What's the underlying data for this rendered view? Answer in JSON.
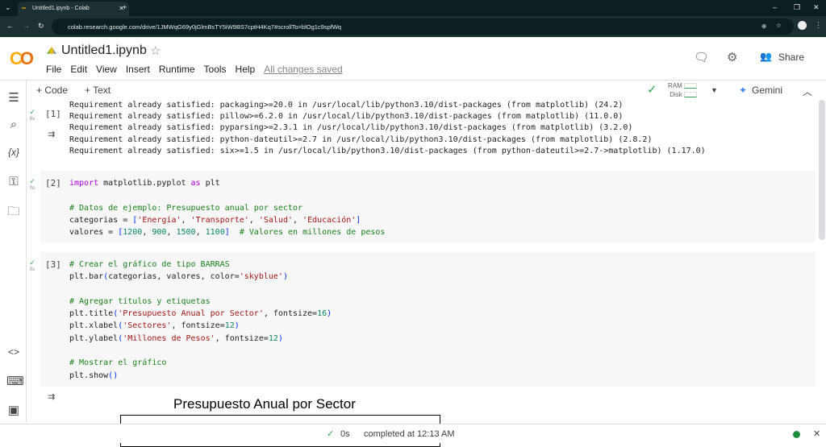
{
  "browser": {
    "tab_title": "Untitled1.ipynb - Colab",
    "url": "colab.research.google.com/drive/1JMWqG69y0jGlmBsTY5iW9BS7cptH4Kq7#scrollTo=blOg1c9spfWq"
  },
  "header": {
    "logo": "CO",
    "title": "Untitled1.ipynb",
    "menu": [
      "File",
      "Edit",
      "View",
      "Insert",
      "Runtime",
      "Tools",
      "Help"
    ],
    "saved": "All changes saved",
    "share": "Share"
  },
  "toolbar": {
    "code": "+ Code",
    "text": "+ Text",
    "ram": "RAM",
    "disk": "Disk",
    "gemini": "Gemini"
  },
  "cells": [
    {
      "num": "[1]",
      "time": "8s",
      "output": [
        "Requirement already satisfied: packaging>=20.0 in /usr/local/lib/python3.10/dist-packages (from matplotlib) (24.2)",
        "Requirement already satisfied: pillow>=6.2.0 in /usr/local/lib/python3.10/dist-packages (from matplotlib) (11.0.0)",
        "Requirement already satisfied: pyparsing>=2.3.1 in /usr/local/lib/python3.10/dist-packages (from matplotlib) (3.2.0)",
        "Requirement already satisfied: python-dateutil>=2.7 in /usr/local/lib/python3.10/dist-packages (from matplotlib) (2.8.2)",
        "Requirement already satisfied: six>=1.5 in /usr/local/lib/python3.10/dist-packages (from python-dateutil>=2.7->matplotlib) (1.17.0)"
      ]
    },
    {
      "num": "[2]",
      "time": "0s",
      "code": [
        "import matplotlib.pyplot as plt",
        "",
        "# Datos de ejemplo: Presupuesto anual por sector",
        "categorias = ['Energía', 'Transporte', 'Salud', 'Educación']",
        "valores = [1200, 900, 1500, 1100]  # Valores en millones de pesos"
      ]
    },
    {
      "num": "[3]",
      "time": "0s",
      "code": [
        "# Crear el gráfico de tipo BARRAS",
        "plt.bar(categorias, valores, color='skyblue')",
        "",
        "# Agregar títulos y etiquetas",
        "plt.title('Presupuesto Anual por Sector', fontsize=16)",
        "plt.xlabel('Sectores', fontsize=12)",
        "plt.ylabel('Millones de Pesos', fontsize=12)",
        "",
        "# Mostrar el gráfico",
        "plt.show()"
      ],
      "chart_title": "Presupuesto Anual por Sector"
    }
  ],
  "status": {
    "time": "0s",
    "text": "completed at 12:13 AM"
  }
}
